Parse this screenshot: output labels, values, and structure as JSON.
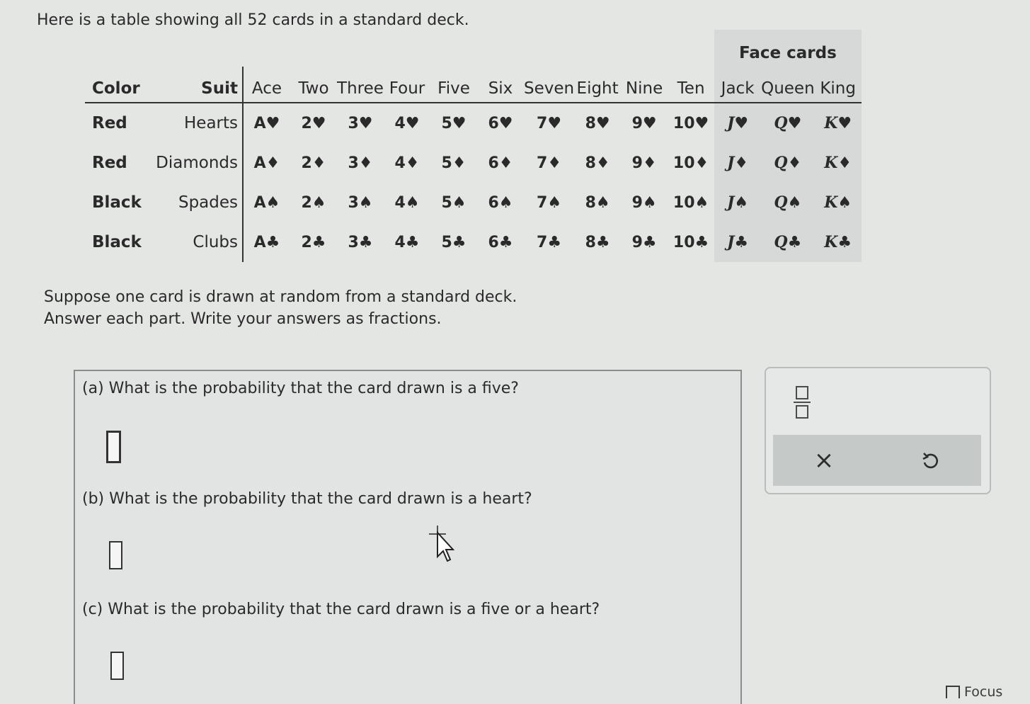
{
  "intro_text": "Here is a table showing all 52 cards in a standard deck.",
  "table": {
    "face_cards_label": "Face cards",
    "color_header": "Color",
    "suit_header": "Suit",
    "ranks": [
      "Ace",
      "Two",
      "Three",
      "Four",
      "Five",
      "Six",
      "Seven",
      "Eight",
      "Nine",
      "Ten",
      "Jack",
      "Queen",
      "King"
    ],
    "rows": [
      {
        "color": "Red",
        "suit": "Hearts",
        "cards": [
          "A♥",
          "2♥",
          "3♥",
          "4♥",
          "5♥",
          "6♥",
          "7♥",
          "8♥",
          "9♥",
          "10♥",
          "J♥",
          "Q♥",
          "K♥"
        ]
      },
      {
        "color": "Red",
        "suit": "Diamonds",
        "cards": [
          "A♦",
          "2♦",
          "3♦",
          "4♦",
          "5♦",
          "6♦",
          "7♦",
          "8♦",
          "9♦",
          "10♦",
          "J♦",
          "Q♦",
          "K♦"
        ]
      },
      {
        "color": "Black",
        "suit": "Spades",
        "cards": [
          "A♠",
          "2♠",
          "3♠",
          "4♠",
          "5♠",
          "6♠",
          "7♠",
          "8♠",
          "9♠",
          "10♠",
          "J♠",
          "Q♠",
          "K♠"
        ]
      },
      {
        "color": "Black",
        "suit": "Clubs",
        "cards": [
          "A♣",
          "2♣",
          "3♣",
          "4♣",
          "5♣",
          "6♣",
          "7♣",
          "8♣",
          "9♣",
          "10♣",
          "J♣",
          "Q♣",
          "K♣"
        ]
      }
    ]
  },
  "prompt": {
    "line1": "Suppose one card is drawn at random from a standard deck.",
    "line2": "Answer each part. Write your answers as fractions."
  },
  "questions": {
    "a": "(a) What is the probability that the card drawn is a five?",
    "b": "(b) What is the probability that the card drawn is a heart?",
    "c": "(c) What is the probability that the card drawn is a five or a heart?"
  },
  "tools": {
    "fraction_icon": "fraction-icon",
    "clear_symbol": "×",
    "undo_icon": "undo-icon"
  },
  "focus_label": "Focus"
}
